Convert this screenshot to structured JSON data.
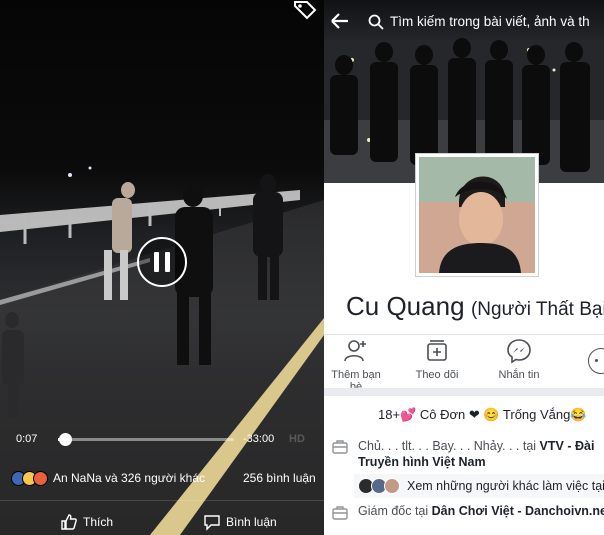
{
  "video": {
    "time_current": "0:07",
    "time_remaining": "-33:00",
    "quality": "HD",
    "progress_fraction": 0.04,
    "reactions_text": "An NaNa và 326 người khác",
    "comments_count": "256 bình luận",
    "like_label": "Thích",
    "comment_label": "Bình luận"
  },
  "profile": {
    "search_placeholder": "Tìm kiếm trong bài viết, ảnh và th",
    "name": "Cu Quang",
    "name_suffix": "(Người Thất Bại",
    "actions": [
      {
        "label": "Thêm bạn bè",
        "icon": "add-friend-icon"
      },
      {
        "label": "Theo dõi",
        "icon": "follow-icon"
      },
      {
        "label": "Nhắn tin",
        "icon": "messenger-icon"
      }
    ],
    "bio": "18+💕 Cô Đơn ❤ 😊 Trống Vắng😂",
    "work1_prefix": "Chủ. . . tlt. . . Bay. . . Nhảy. . . tại ",
    "work1_org": "VTV - Đài Truyền hình Việt Nam",
    "coworkers_text": "Xem những người khác làm việc tại",
    "work2_prefix": "Giám đốc tại ",
    "work2_org": "Dân Chơi Việt - Danchoivn.net"
  },
  "colors": {
    "accent": "#4267b2",
    "text": "#1d2129",
    "muted": "#90949c"
  }
}
